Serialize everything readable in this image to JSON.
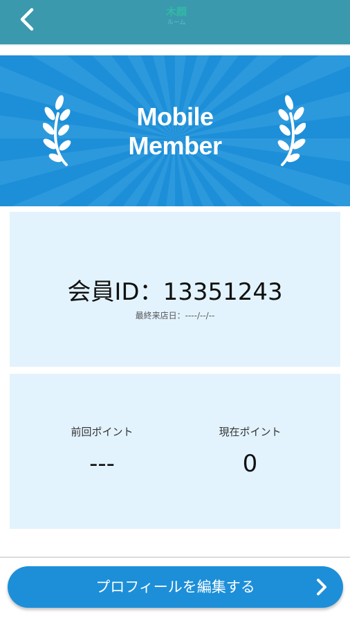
{
  "header": {
    "logo_mark": "木顔",
    "logo_sub": "ルーム"
  },
  "banner": {
    "line1": "Mobile",
    "line2": "Member"
  },
  "member_card": {
    "member_id": "会員ID：13351243",
    "last_visit": "最終来店日：----/--/--"
  },
  "points": {
    "previous_label": "前回ポイント",
    "previous_value": "---",
    "current_label": "現在ポイント",
    "current_value": "0"
  },
  "actions": {
    "edit_profile_label": "プロフィールを編集する"
  },
  "icons": {
    "back": "chevron-left-icon",
    "next": "chevron-right-icon",
    "laurel": "laurel-icon"
  },
  "colors": {
    "header": "#3a99ad",
    "banner": "#1d8fd8",
    "card": "#e3f3fd",
    "button": "#1d8fd8"
  }
}
